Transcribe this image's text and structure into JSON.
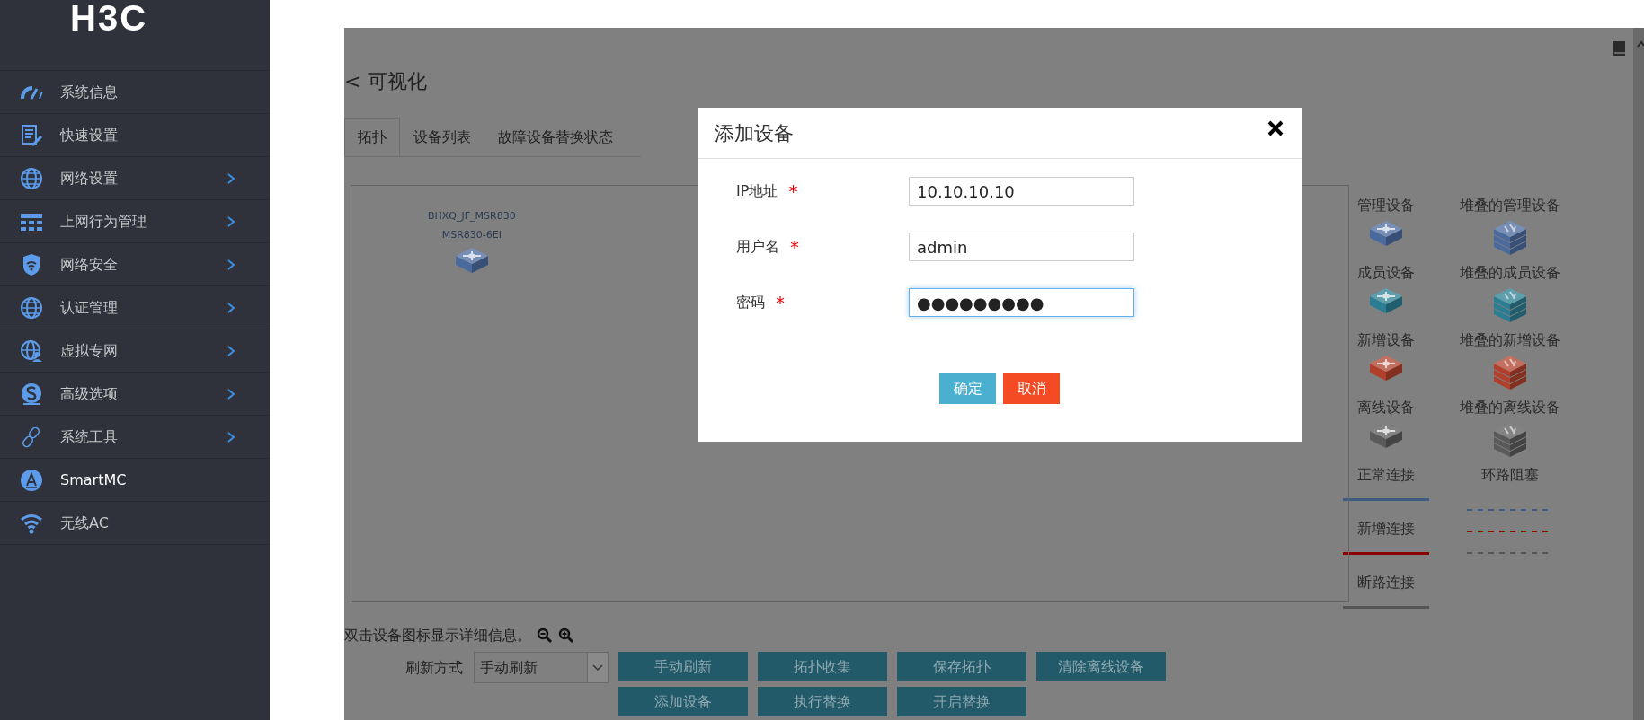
{
  "sidebar": {
    "logo": "H3C",
    "items": [
      {
        "label": "系统信息",
        "expandable": false,
        "selected": false
      },
      {
        "label": "快速设置",
        "expandable": false,
        "selected": false
      },
      {
        "label": "网络设置",
        "expandable": true,
        "selected": false
      },
      {
        "label": "上网行为管理",
        "expandable": true,
        "selected": false
      },
      {
        "label": "网络安全",
        "expandable": true,
        "selected": false
      },
      {
        "label": "认证管理",
        "expandable": true,
        "selected": false
      },
      {
        "label": "虚拟专网",
        "expandable": true,
        "selected": false
      },
      {
        "label": "高级选项",
        "expandable": true,
        "selected": false
      },
      {
        "label": "系统工具",
        "expandable": true,
        "selected": false
      },
      {
        "label": "SmartMC",
        "expandable": false,
        "selected": true
      },
      {
        "label": "无线AC",
        "expandable": false,
        "selected": false
      }
    ]
  },
  "page": {
    "back": "<",
    "title": "可视化"
  },
  "tabs": [
    {
      "label": "拓扑",
      "selected": true
    },
    {
      "label": "设备列表",
      "selected": false
    },
    {
      "label": "故障设备替换状态",
      "selected": false
    }
  ],
  "topology": {
    "devices": [
      {
        "name": "BHXQ_JF_MSR830",
        "model": "MSR830-6EI",
        "color": "#4a6a9e"
      }
    ]
  },
  "legend": {
    "devices": [
      {
        "label": "管理设备",
        "kind": "single",
        "color": "#4a6a9e"
      },
      {
        "label": "堆叠的管理设备",
        "kind": "stack",
        "color": "#4a6a9e"
      },
      {
        "label": "成员设备",
        "kind": "single",
        "color": "#2a7d92"
      },
      {
        "label": "堆叠的成员设备",
        "kind": "stack",
        "color": "#2a7d92"
      },
      {
        "label": "新增设备",
        "kind": "single",
        "color": "#b0402c"
      },
      {
        "label": "堆叠的新增设备",
        "kind": "stack",
        "color": "#b0402c"
      },
      {
        "label": "离线设备",
        "kind": "single",
        "color": "#5a5a5a"
      },
      {
        "label": "堆叠的离线设备",
        "kind": "stack",
        "color": "#5a5a5a"
      }
    ],
    "links": [
      {
        "label": "正常连接",
        "color": "#405a80"
      },
      {
        "label": "新增连接",
        "color": "#8b0000"
      },
      {
        "label": "断路连接",
        "color": "#555555"
      }
    ],
    "blocked": {
      "label": "环路阻塞",
      "lines": [
        {
          "color": "#405a80"
        },
        {
          "color": "#8b0000"
        },
        {
          "color": "#555555"
        }
      ]
    }
  },
  "hint": "双击设备图标显示详细信息。",
  "refresh": {
    "label": "刷新方式",
    "value": "手动刷新"
  },
  "actions": [
    "手动刷新",
    "拓扑收集",
    "保存拓扑",
    "清除离线设备",
    "添加设备",
    "执行替换",
    "开启替换"
  ],
  "dialog": {
    "title": "添加设备",
    "fields": [
      {
        "label": "IP地址",
        "required_mark": "*",
        "value": "10.10.10.10",
        "focused": false
      },
      {
        "label": "用户名",
        "required_mark": "*",
        "value": "admin",
        "focused": false
      },
      {
        "label": "密码",
        "required_mark": "*",
        "value": "●●●●●●●●●",
        "focused": true
      }
    ],
    "buttons": [
      {
        "label": "确定",
        "kind": "confirm"
      },
      {
        "label": "取消",
        "kind": "cancel"
      }
    ]
  }
}
